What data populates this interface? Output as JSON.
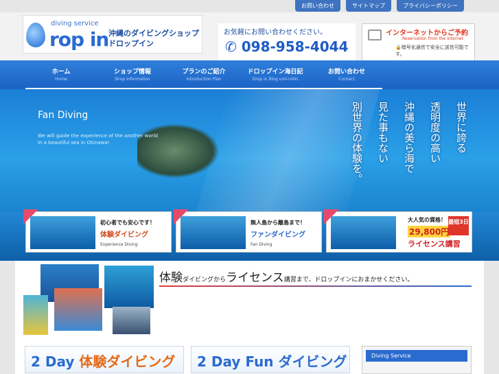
{
  "topnav": {
    "contact": "お問い合わせ",
    "sitemap": "サイトマップ",
    "privacy": "プライバシーポリシー"
  },
  "logo": {
    "service": "diving service",
    "brand": "rop in",
    "shop_line1": "沖縄のダイビングショップ",
    "shop_line2": "ドロップイン"
  },
  "contact": {
    "prompt": "お気軽にお問い合わせください。",
    "phone": "098-958-4044"
  },
  "reservation": {
    "title": "インターネットからご予約",
    "subtitle": "Reservation from the internet",
    "note": "暗号化通信で安全に送信可能です。"
  },
  "nav": [
    {
      "ja": "ホーム",
      "en": "Home"
    },
    {
      "ja": "ショップ情報",
      "en": "Shop Information"
    },
    {
      "ja": "プランのご紹介",
      "en": "Introduction Plan"
    },
    {
      "ja": "ドロップイン海日記",
      "en": "Drop in Blog umi-nikki"
    },
    {
      "ja": "お問い合わせ",
      "en": "Contact"
    }
  ],
  "hero": {
    "title": "Fan Diving",
    "subtitle": "We will guide the experience of the another world in a beautiful sea in Okinawa!",
    "vertical": [
      "世界に誇る",
      "透明度の高い",
      "沖縄の美ら海で",
      "見た事もない",
      "別世界の体験を。"
    ]
  },
  "banners": [
    {
      "line1": "初心者でも安心です！",
      "line2": "体験ダイビング",
      "line3": "Experience Diving"
    },
    {
      "line1": "無人島から離島まで！",
      "line2": "ファンダイビング",
      "line3": "Fan Diving"
    },
    {
      "line1": "大人気の資格！",
      "line2": "29,800円",
      "line3": "ライセンス講習",
      "badge": "最短3日"
    }
  ],
  "tagline": {
    "part1": "体験",
    "part2": "ダイビングから",
    "part3": "ライセンス",
    "part4": "講習まで、ドロップインにおまかせください。"
  },
  "boxes": {
    "box1_num": "2 Day ",
    "box1_text": "体験ダイビング",
    "box2": "2 Day Fun ダイビング"
  },
  "sidebar": {
    "heading": "Diving Service"
  }
}
